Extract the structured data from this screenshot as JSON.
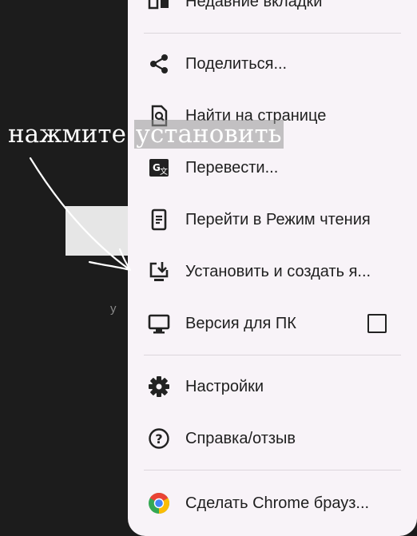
{
  "background": {
    "partial_text": "у м"
  },
  "annotation": {
    "prefix": "нажмите ",
    "highlight": "установить"
  },
  "menu": {
    "items": [
      {
        "label": "Недавние вкладки",
        "icon": "recent-tabs-icon"
      },
      {
        "label": "Поделиться...",
        "icon": "share-icon"
      },
      {
        "label": "Найти на странице",
        "icon": "find-in-page-icon"
      },
      {
        "label": "Перевести...",
        "icon": "translate-icon"
      },
      {
        "label": "Перейти в Режим чтения",
        "icon": "reader-mode-icon"
      },
      {
        "label": "Установить и создать я...",
        "icon": "install-app-icon"
      },
      {
        "label": "Версия для ПК",
        "icon": "desktop-icon",
        "checkbox": false
      },
      {
        "label": "Настройки",
        "icon": "settings-gear-icon"
      },
      {
        "label": "Справка/отзыв",
        "icon": "help-icon"
      },
      {
        "label": "Сделать Chrome брауз...",
        "icon": "chrome-logo-icon"
      }
    ]
  },
  "colors": {
    "menu_background": "#f8f3f8",
    "page_background": "#1c1c1c",
    "text": "#1f1f1f"
  }
}
